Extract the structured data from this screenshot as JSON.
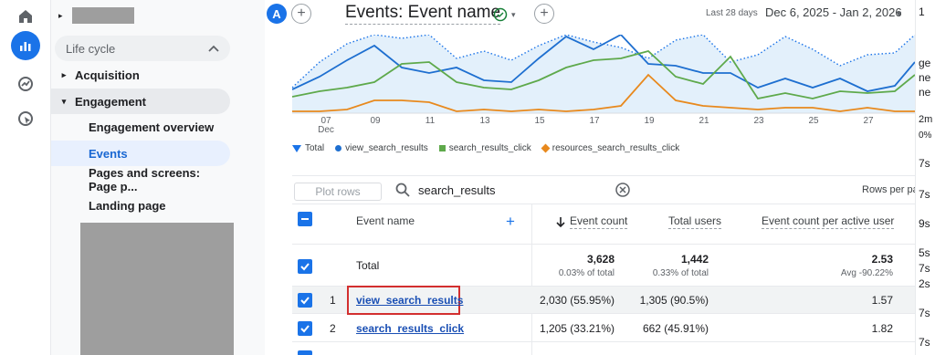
{
  "rail": {
    "icons": [
      "home-icon",
      "reports-icon",
      "explore-icon",
      "advertising-icon"
    ]
  },
  "nav": {
    "section_label": "Life cycle",
    "items": [
      {
        "label": "Acquisition"
      },
      {
        "label": "Engagement"
      },
      {
        "label": "Engagement overview"
      },
      {
        "label": "Events"
      },
      {
        "label": "Pages and screens: Page p..."
      },
      {
        "label": "Landing page"
      }
    ]
  },
  "header": {
    "avatar_letter": "A",
    "title": "Events: Event name",
    "date_label": "Last 28 days",
    "date_range": "Dec 6, 2025 - Jan 2, 2026"
  },
  "chart_data": {
    "type": "line",
    "x": [
      "07 Dec",
      "09",
      "11",
      "13",
      "15",
      "17",
      "19",
      "21",
      "23",
      "25",
      "27"
    ],
    "x_tick_labels": [
      "07",
      "09",
      "11",
      "13",
      "15",
      "17",
      "19",
      "21",
      "23",
      "25",
      "27"
    ],
    "x_sublabel": "Dec",
    "series": [
      {
        "name": "Total",
        "color": "#1a73e8",
        "style": "dotted"
      },
      {
        "name": "view_search_results",
        "color": "#1e6fd0"
      },
      {
        "name": "search_results_click",
        "color": "#5ea94b"
      },
      {
        "name": "resources_search_results_click",
        "color": "#e8891d"
      }
    ]
  },
  "filter": {
    "plot_rows_label": "Plot rows",
    "search_value": "search_results",
    "rows_per_page_label": "Rows per pa"
  },
  "table": {
    "headers": {
      "event_name": "Event name",
      "event_count": "Event count",
      "total_users": "Total users",
      "event_count_per_user": "Event count per active user"
    },
    "total": {
      "label": "Total",
      "event_count": "3,628",
      "event_count_sub": "0.03% of total",
      "total_users": "1,442",
      "total_users_sub": "0.33% of total",
      "per_user": "2.53",
      "per_user_sub": "Avg -90.22%"
    },
    "rows": [
      {
        "index": "1",
        "event_name": "view_search_results",
        "event_count": "2,030 (55.95%)",
        "total_users": "1,305 (90.5%)",
        "per_user": "1.57"
      },
      {
        "index": "2",
        "event_name": "search_results_click",
        "event_count": "1,205 (33.21%)",
        "total_users": "662 (45.91%)",
        "per_user": "1.82"
      }
    ]
  },
  "right_edge": {
    "texts": [
      "1",
      "ge",
      "ne",
      "ne",
      "2m",
      "0%",
      "7s",
      "7s",
      "9s",
      "5s",
      "7s",
      "2s",
      "7s",
      "7s"
    ]
  }
}
